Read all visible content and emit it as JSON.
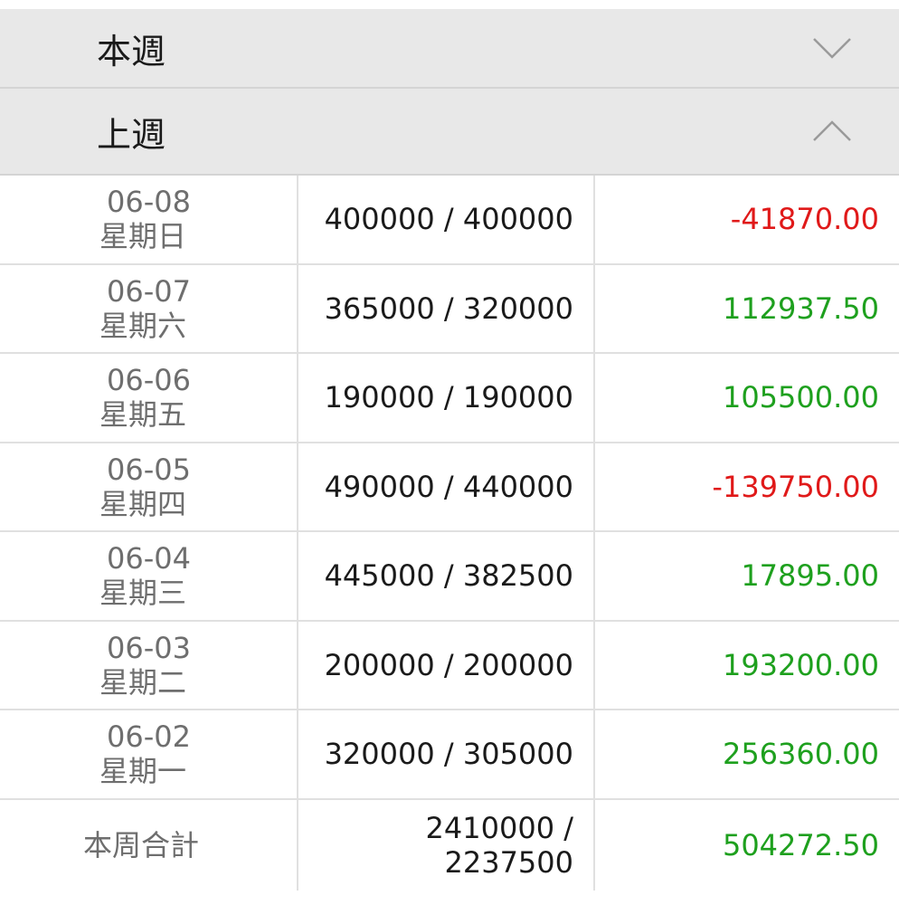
{
  "sections": {
    "this_week": {
      "title": "本週",
      "icon": "chevron-down-icon"
    },
    "last_week": {
      "title": "上週",
      "icon": "chevron-up-icon"
    }
  },
  "rows": [
    {
      "date": "06-08",
      "weekday": "星期日",
      "amount": "400000 / 400000",
      "profit": "-41870.00",
      "sign": "neg"
    },
    {
      "date": "06-07",
      "weekday": "星期六",
      "amount": "365000 / 320000",
      "profit": "112937.50",
      "sign": "pos"
    },
    {
      "date": "06-06",
      "weekday": "星期五",
      "amount": "190000 / 190000",
      "profit": "105500.00",
      "sign": "pos"
    },
    {
      "date": "06-05",
      "weekday": "星期四",
      "amount": "490000 / 440000",
      "profit": "-139750.00",
      "sign": "neg"
    },
    {
      "date": "06-04",
      "weekday": "星期三",
      "amount": "445000 / 382500",
      "profit": "17895.00",
      "sign": "pos"
    },
    {
      "date": "06-03",
      "weekday": "星期二",
      "amount": "200000 / 200000",
      "profit": "193200.00",
      "sign": "pos"
    },
    {
      "date": "06-02",
      "weekday": "星期一",
      "amount": "320000 / 305000",
      "profit": "256360.00",
      "sign": "pos"
    }
  ],
  "total": {
    "label": "本周合計",
    "amount_line1": "2410000 /",
    "amount_line2": "2237500",
    "profit": "504272.50"
  },
  "colors": {
    "negative": "#e01919",
    "positive": "#1ea01e",
    "header_bg": "#e8e8e8"
  }
}
